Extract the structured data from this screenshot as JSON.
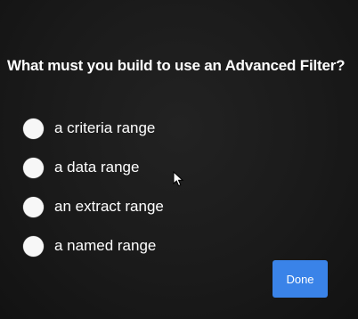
{
  "question": {
    "text": "What must you build to use an Advanced Filter?"
  },
  "options": [
    {
      "label": "a criteria range",
      "selected": false
    },
    {
      "label": "a data range",
      "selected": false
    },
    {
      "label": "an extract range",
      "selected": false
    },
    {
      "label": "a named range",
      "selected": false
    }
  ],
  "done_button": {
    "label": "Done"
  },
  "colors": {
    "background": "#1a1a1a",
    "text": "#ffffff",
    "radio": "#f7f7f7",
    "accent": "#3a83e8"
  },
  "icons": {
    "cursor": "mouse-pointer-icon"
  }
}
